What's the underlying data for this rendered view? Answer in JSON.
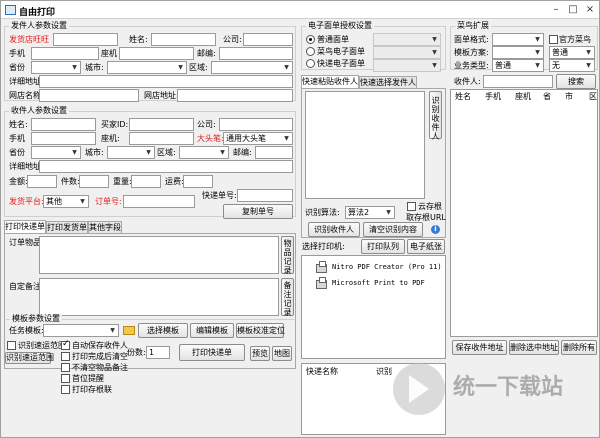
{
  "app": {
    "title": "自由打印"
  },
  "sender": {
    "group": "发件人参数设置",
    "wangwang": "发货店旺旺",
    "name": "姓名:",
    "company": "公司:",
    "mobile": "手机",
    "landline": "座机",
    "postcode": "邮编:",
    "province": "省份",
    "city": "城市:",
    "district": "区域:",
    "address": "详细地址",
    "shop_name": "网店名称",
    "shop_url": "网店地址:"
  },
  "receiver": {
    "group": "收件人参数设置",
    "name": "姓名:",
    "buyer_id": "买家ID:",
    "company": "公司:",
    "mobile": "手机",
    "landline": "座机:",
    "big_head": "大头笔:",
    "big_head_value": "通用大头笔",
    "province": "省份",
    "city": "城市:",
    "district": "区域:",
    "postcode": "邮编:",
    "address": "详细地址",
    "amount": "金额:",
    "pieces": "件数:",
    "weight": "重量:",
    "freight": "运费:",
    "platform": "发货平台:",
    "platform_value": "其他",
    "order_no": "订单号:",
    "tracking_no": "快递单号:",
    "copy_btn": "复制单号"
  },
  "left_tabs": [
    "打印快递单",
    "打印发货单",
    "其他字段"
  ],
  "print_area": {
    "goods": "订单物品:",
    "goods_btn": "物品记录",
    "remark": "自定备注:",
    "remark_btn": "备注记录",
    "template_group": "模板参数设置",
    "template": "任务模板:",
    "select_tpl": "选择模板",
    "edit_tpl": "编辑模板",
    "locate_tpl": "模板校准定位",
    "chk_recognize": "识别速运范围",
    "btn_recognize": "识别速运范围",
    "chk_save": "自动保存收件人",
    "chk_clear": "打印完成后清空",
    "chk_nogoods": "不清空物品备注",
    "chk_first": "首位提醒",
    "chk_log": "打印存根联",
    "copies_label": "份数:",
    "copies_value": "1",
    "print_btn": "打印快递单",
    "preview": "预览",
    "map": "地图"
  },
  "eorder": {
    "group": "电子面单授权设置",
    "radios": [
      "普通面单",
      "菜鸟电子面单",
      "快递电子面单"
    ],
    "tabs": [
      "快速粘贴收件人",
      "快速选择发件人"
    ],
    "side_btn": "识别收件人",
    "algo": "识别算法:",
    "algo_value": "算法2",
    "chk_cloud": "云存根",
    "fetch_url": "取存根URL",
    "recog_btn": "识别收件人",
    "clear_btn": "清空识别内容",
    "printer_label": "选择打印机:",
    "print_queue": "打印队列",
    "printer_test": "电子纸张",
    "printers": [
      "Nitro PDF Creator (Pro 11)",
      "Microsoft Print to PDF"
    ],
    "list_cols": [
      "快递名称",
      "识别"
    ]
  },
  "cainiao": {
    "group": "菜鸟扩展",
    "format": "面单格式:",
    "chk_official": "官方菜鸟",
    "template": "模板方案:",
    "template_value": "普通",
    "biz": "业务类型:",
    "biz_value": "普通",
    "biz_value2": "无",
    "receiver": "收件人:",
    "search": "搜索",
    "cols": [
      "姓名",
      "手机",
      "座机",
      "省",
      "市",
      "区"
    ],
    "save_btn": "保存收件地址",
    "del_sel": "删除选中地址",
    "del_all": "删除所有"
  },
  "watermark": {
    "text": "统一下载站"
  }
}
